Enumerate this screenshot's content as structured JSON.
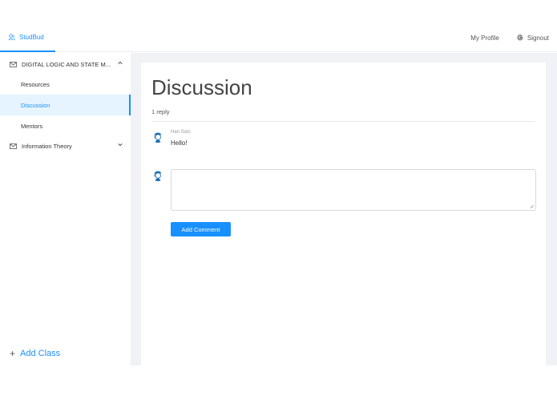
{
  "header": {
    "brand": "StudBud",
    "my_profile": "My Profile",
    "signout": "Signout"
  },
  "sidebar": {
    "groups": [
      {
        "label": "DIGITAL LOGIC AND STATE M...",
        "expanded": true,
        "items": [
          "Resources",
          "Discussion",
          "Mentors"
        ],
        "active_item": "Discussion"
      },
      {
        "label": "Information Theory",
        "expanded": false
      }
    ],
    "add_class": "Add Class"
  },
  "main": {
    "title": "Discussion",
    "reply_count": "1 reply",
    "comments": [
      {
        "author": "Han Solo",
        "text": "Hello!"
      }
    ],
    "comment_input_value": "",
    "add_comment_label": "Add Comment"
  },
  "colors": {
    "accent": "#1890ff",
    "content_bg": "#f0f2f5",
    "active_item_bg": "#e6f4ff"
  },
  "icons": {
    "brand": "user-group-icon",
    "signout": "google-icon",
    "group": "mail-icon",
    "expanded": "chevron-up-icon",
    "collapsed": "chevron-down-icon",
    "add": "plus-icon",
    "avatar": "user-avatar-icon"
  }
}
